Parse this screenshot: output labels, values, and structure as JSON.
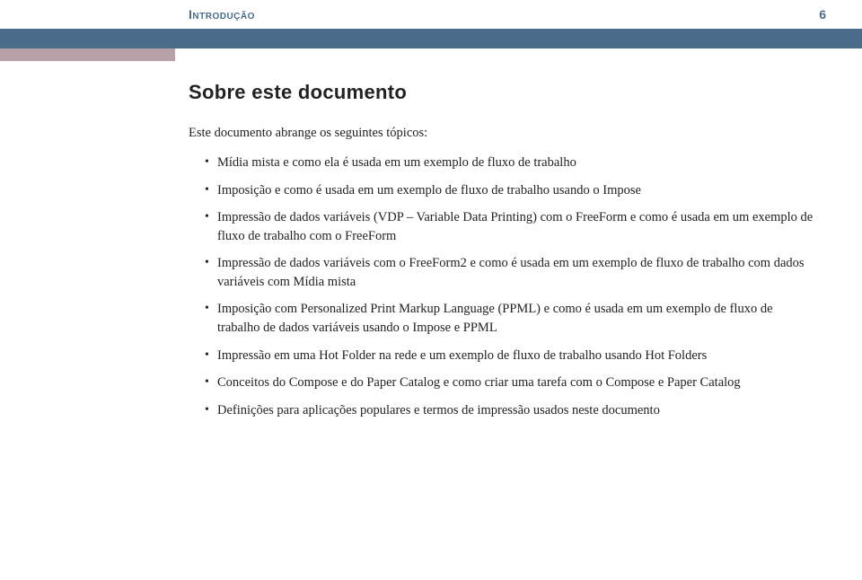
{
  "header": {
    "section_label": "Introdução",
    "page_number": "6"
  },
  "title": "Sobre este documento",
  "intro_text": "Este documento abrange os seguintes tópicos:",
  "bullets": [
    "Mídia mista e como ela é usada em um exemplo de fluxo de trabalho",
    "Imposição e como é usada em um exemplo de fluxo de trabalho usando o Impose",
    "Impressão de dados variáveis (VDP – Variable Data Printing) com o FreeForm e como é usada em um exemplo de fluxo de trabalho com o FreeForm",
    "Impressão de dados variáveis com o FreeForm2 e como é usada em um exemplo de fluxo de trabalho com dados variáveis com Mídia mista",
    "Imposição com Personalized Print Markup Language (PPML) e como é usada em um exemplo de fluxo de trabalho de dados variáveis usando o Impose e PPML",
    "Impressão em uma Hot Folder na rede e um exemplo de fluxo de trabalho usando Hot Folders",
    "Conceitos do Compose e do Paper Catalog e como criar uma tarefa com o Compose e Paper Catalog",
    "Definições para aplicações populares e termos de impressão usados neste documento"
  ]
}
